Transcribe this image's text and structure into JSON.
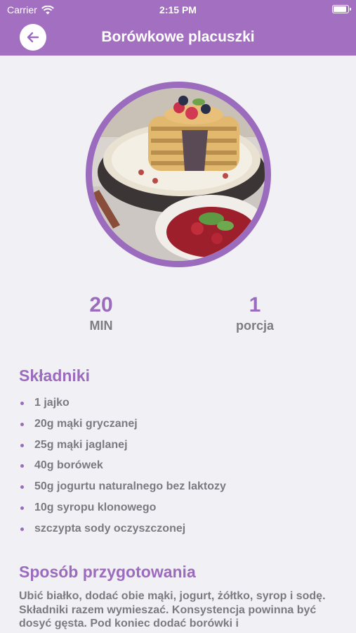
{
  "status_bar": {
    "carrier": "Carrier",
    "time": "2:15 PM"
  },
  "nav": {
    "title": "Borówkowe placuszki"
  },
  "stats": {
    "time_value": "20",
    "time_unit": "MIN",
    "portion_value": "1",
    "portion_unit": "porcja"
  },
  "ingredients": {
    "title": "Składniki",
    "items": [
      "1 jajko",
      "20g mąki gryczanej",
      "25g mąki jaglanej",
      "40g borówek",
      "50g jogurtu naturalnego bez laktozy",
      "10g syropu klonowego",
      "szczypta sody oczyszczonej"
    ]
  },
  "method": {
    "title": "Sposób przygotowania",
    "text": "Ubić białko, dodać obie mąki, jogurt, żółtko, syrop i sodę. Składniki razem wymieszać. Konsystencja powinna być dosyć gęsta. Pod koniec dodać borówki i"
  },
  "colors": {
    "accent": "#9b6cbd",
    "header": "#a36fc0",
    "background": "#f1f0f5",
    "text": "#7a7a80"
  }
}
